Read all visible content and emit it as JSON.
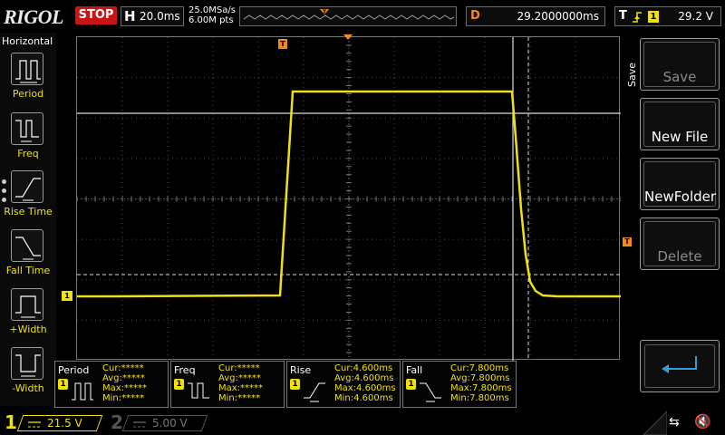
{
  "topbar": {
    "brand": "RIGOL",
    "run_state": "STOP",
    "timebase_tag": "H",
    "timebase": "20.0ms",
    "sample_rate": "25.0MSa/s",
    "memory_depth": "6.00M pts",
    "delay_tag": "D",
    "delay": "29.2000000ms",
    "trigger_tag": "T",
    "trigger_source": "1",
    "trigger_level": "29.2 V"
  },
  "markers": {
    "trigger_pos": "T",
    "trigger_level": "T",
    "ch1": "1"
  },
  "left_menu": {
    "title": "Horizontal",
    "items": [
      "Period",
      "Freq",
      "Rise Time",
      "Fall Time",
      "+Width",
      "-Width"
    ]
  },
  "right_menu": {
    "title": "Save",
    "buttons": [
      {
        "label": "Save",
        "enabled": false
      },
      {
        "label": "New File",
        "enabled": true
      },
      {
        "label": "NewFolder",
        "enabled": true
      },
      {
        "label": "Delete",
        "enabled": false
      }
    ]
  },
  "measurements": [
    {
      "title": "Period",
      "channel": "1",
      "cur": "Cur:*****",
      "avg": "Avg:*****",
      "max": "Max:*****",
      "min": "Min:*****"
    },
    {
      "title": "Freq",
      "channel": "1",
      "cur": "Cur:*****",
      "avg": "Avg:*****",
      "max": "Max:*****",
      "min": "Min:*****"
    },
    {
      "title": "Rise",
      "channel": "1",
      "cur": "Cur:4.600ms",
      "avg": "Avg:4.600ms",
      "max": "Max:4.600ms",
      "min": "Min:4.600ms"
    },
    {
      "title": "Fall",
      "channel": "1",
      "cur": "Cur:7.800ms",
      "avg": "Avg:7.800ms",
      "max": "Max:7.800ms",
      "min": "Min:7.800ms"
    }
  ],
  "channels": {
    "ch1": {
      "number": "1",
      "scale": "21.5 V"
    },
    "ch2": {
      "number": "2",
      "scale": "5.00 V"
    }
  },
  "colors": {
    "ch1": "#f0e010",
    "trigger": "#f08a1a",
    "stop": "#c81414"
  }
}
